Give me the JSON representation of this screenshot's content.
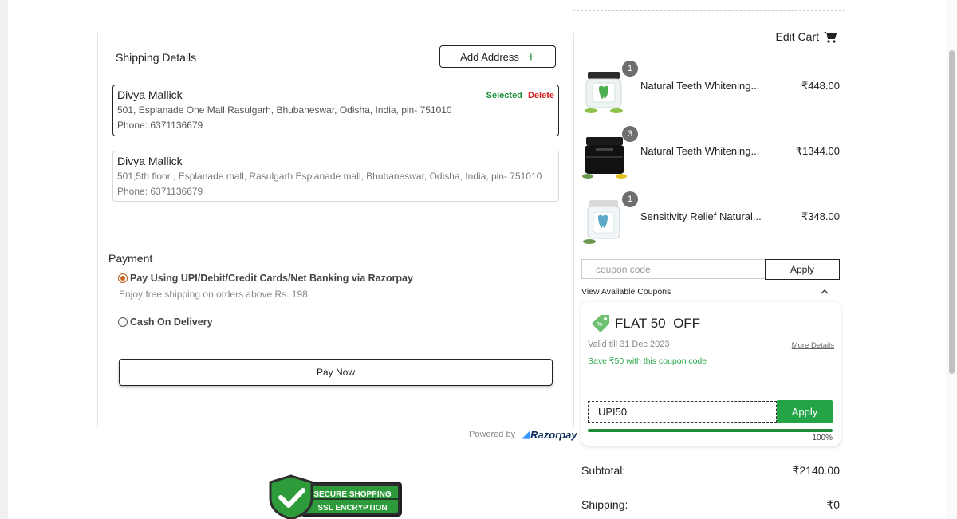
{
  "shipping": {
    "title": "Shipping Details",
    "add_address_label": "Add Address",
    "addresses": [
      {
        "name": "Divya Mallick",
        "address": "501, Esplanade One Mall Rasulgarh, Bhubaneswar, Odisha, India, pin- 751010",
        "phone": "Phone: 6371136679",
        "selected_label": "Selected",
        "delete_label": "Delete"
      },
      {
        "name": "Divya Mallick",
        "address": "501,5th floor , Esplanade mall, Rasulgarh Esplanade mall, Bhubaneswar, Odisha, India, pin- 751010",
        "phone": "Phone: 6371136679"
      }
    ]
  },
  "payment": {
    "title": "Payment",
    "options": [
      {
        "label": "Pay Using UPI/Debit/Credit Cards/Net Banking via Razorpay",
        "selected": true
      },
      {
        "label": "Cash On Delivery",
        "selected": false
      }
    ],
    "free_shipping_note": "Enjoy free shipping on orders above Rs. 198",
    "pay_now_label": "Pay Now",
    "powered_by": "Powered by",
    "razorpay": "Razorpay"
  },
  "badge": {
    "line1": "SECURE SHOPPING",
    "line2": "SSL ENCRYPTION"
  },
  "cart": {
    "edit_label": "Edit Cart",
    "items": [
      {
        "qty": "1",
        "name": "Natural Teeth Whitening...",
        "price": "₹448.00"
      },
      {
        "qty": "3",
        "name": "Natural Teeth Whitening...",
        "price": "₹1344.00"
      },
      {
        "qty": "1",
        "name": "Sensitivity Relief Natural...",
        "price": "₹348.00"
      }
    ],
    "coupon_placeholder": "coupon code",
    "apply_label": "Apply",
    "view_coupons_label": "View Available Coupons",
    "coupon": {
      "title": "FLAT 50  OFF",
      "validity": "Valid till 31 Dec 2023",
      "more_details": "More Details",
      "save_text": "Save ₹50 with this coupon code",
      "code": "UPI50",
      "apply_label": "Apply",
      "progress": 100,
      "progress_label": "100%"
    },
    "subtotal_label": "Subtotal:",
    "subtotal_value": "₹2140.00",
    "shipping_label": "Shipping:",
    "shipping_value": "₹0"
  },
  "colors": {
    "accent_green": "#22a447",
    "delete_red": "#d32020",
    "razorpay_blue": "#0b2a5b"
  }
}
